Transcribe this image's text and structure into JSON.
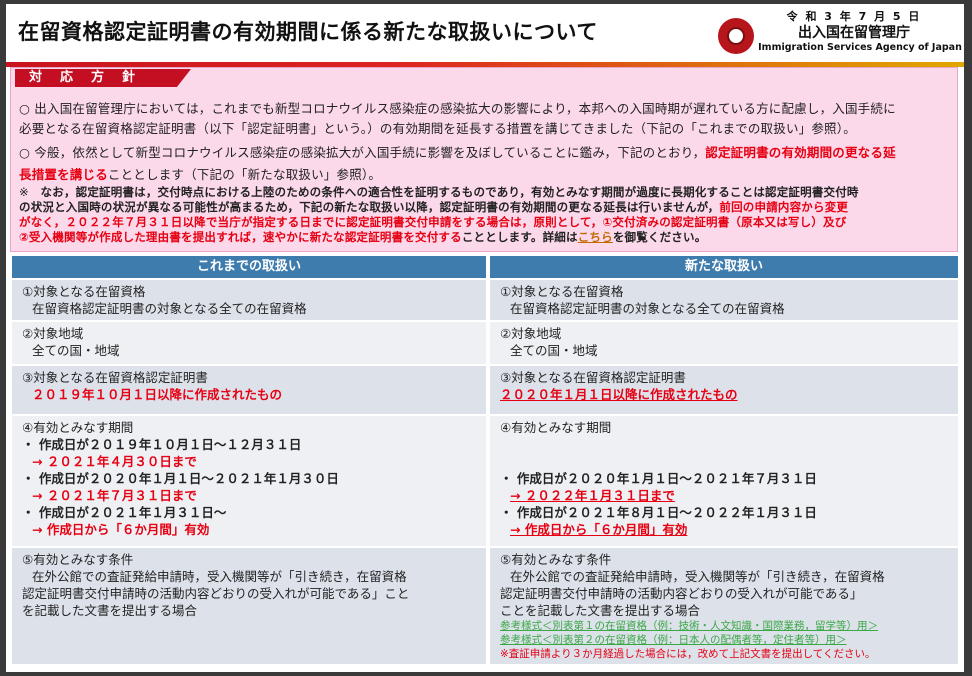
{
  "header": {
    "title": "在留資格認定証明書の有効期間に係る新たな取扱いについて",
    "date": "令 和 3 年 7 月 5 日",
    "agency": "出入国在留管理庁",
    "agency_en": "Immigration Services Agency of Japan",
    "logo_icon": "agency-emblem-icon"
  },
  "policy": {
    "label": "対応方針",
    "b1_bullet": "○",
    "b1_line1": "出入国在留管理庁においては，これまでも新型コロナウイルス感染症の感染拡大の影響により，本邦への入国時期が遅れている方に配慮し，入国手続に",
    "b1_line2": "必要となる在留資格認定証明書（以下「認定証明書」という。）の有効期間を延長する措置を講じてきました（下記の「これまでの取扱い」参照）。",
    "b2_bullet": "○",
    "b2_line1": "今般，依然として新型コロナウイルス感染症の感染拡大が入国手続に影響を及ぼしていることに鑑み，下記のとおり，",
    "b2_line1_red": "認定証明書の有効期間の更なる延",
    "b2_line2_red": "長措置を講じる",
    "b2_line2": "こととします（下記の「新たな取扱い」参照）。",
    "note_mark": "※",
    "note_line1": "なお，認定証明書は，交付時点における上陸のための条件への適合性を証明するものであり，有効とみなす期間が過度に長期化することは認定証明書交付時",
    "note_line2": "の状況と入国時の状況が異なる可能性が高まるため，下記の新たな取扱い以降，認定証明書の有効期間の更なる延長は行いませんが，",
    "note_line2_red": "前回の申請内容から変更",
    "note_line3_red": "がなく，２０２２年７月３１日以降で当庁が指定する日までに認定証明書交付申請をする場合は，原則として，①交付済みの認定証明書（原本又は写し）及び",
    "note_line4_red": "②受入機関等が作成した理由書を提出すれば，速やかに新たな認定証明書を交付する",
    "note_line4": "こととします。詳細は",
    "note_link": "こちら",
    "note_line4_end": "を御覧ください。"
  },
  "table": {
    "col_old": "これまでの取扱い",
    "col_new": "新たな取扱い",
    "old": {
      "r1_title": "①対象となる在留資格",
      "r1_body": "在留資格認定証明書の対象となる全ての在留資格",
      "r2_title": "②対象地域",
      "r2_body": "全ての国・地域",
      "r3_title": "③対象となる在留資格認定証明書",
      "r3_body": "２０１９年１０月１日以降に作成されたもの",
      "r4_title": "④有効とみなす期間",
      "r4_a": "・ 作成日が２０１９年１０月１日～１２月３１日",
      "r4_a_res": "→ ２０２１年４月３０日まで",
      "r4_b": "・ 作成日が２０２０年１月１日～２０２１年１月３０日",
      "r4_b_res": "→ ２０２１年７月３１日まで",
      "r4_c": "・ 作成日が２０２１年１月３１日～",
      "r4_c_res": "→ 作成日から「６か月間」有効",
      "r5_title": "⑤有効とみなす条件",
      "r5_l1": "在外公館での査証発給申請時，受入機関等が「引き続き，在留資格",
      "r5_l2": "認定証明書交付申請時の活動内容どおりの受入れが可能である」こと",
      "r5_l3": "を記載した文書を提出する場合"
    },
    "new": {
      "r1_title": "①対象となる在留資格",
      "r1_body": "在留資格認定証明書の対象となる全ての在留資格",
      "r2_title": "②対象地域",
      "r2_body": "全ての国・地域",
      "r3_title": "③対象となる在留資格認定証明書",
      "r3_body": "２０２０年１月１日以降に作成されたもの",
      "r4_title": "④有効とみなす期間",
      "r4_a": "・ 作成日が２０２０年１月１日～２０２１年７月３１日",
      "r4_a_res": "→ ２０２２年１月３１日まで",
      "r4_b": "・ 作成日が２０２１年８月１日～２０２２年１月３１日",
      "r4_b_res": "→ 作成日から「６か月間」有効",
      "r5_title": "⑤有効とみなす条件",
      "r5_l1": "在外公館での査証発給申請時，受入機関等が「引き続き，在留資格",
      "r5_l2": "認定証明書交付申請時の活動内容どおりの受入れが可能である」",
      "r5_l3": "ことを記載した文書を提出する場合",
      "r5_ref1": "参考様式＜別表第１の在留資格（例：技術・人文知識・国際業務，留学等）用＞",
      "r5_ref2": "参考様式＜別表第２の在留資格（例：日本人の配偶者等，定住者等）用＞",
      "r5_note": "※査証申請より３か月経過した場合には，改めて上記文書を提出してください。"
    }
  },
  "colors": {
    "accent_red": "#e60012",
    "header_blue": "#3f7cae",
    "policy_pink": "#fbd8ea",
    "link_green": "#39a845"
  }
}
